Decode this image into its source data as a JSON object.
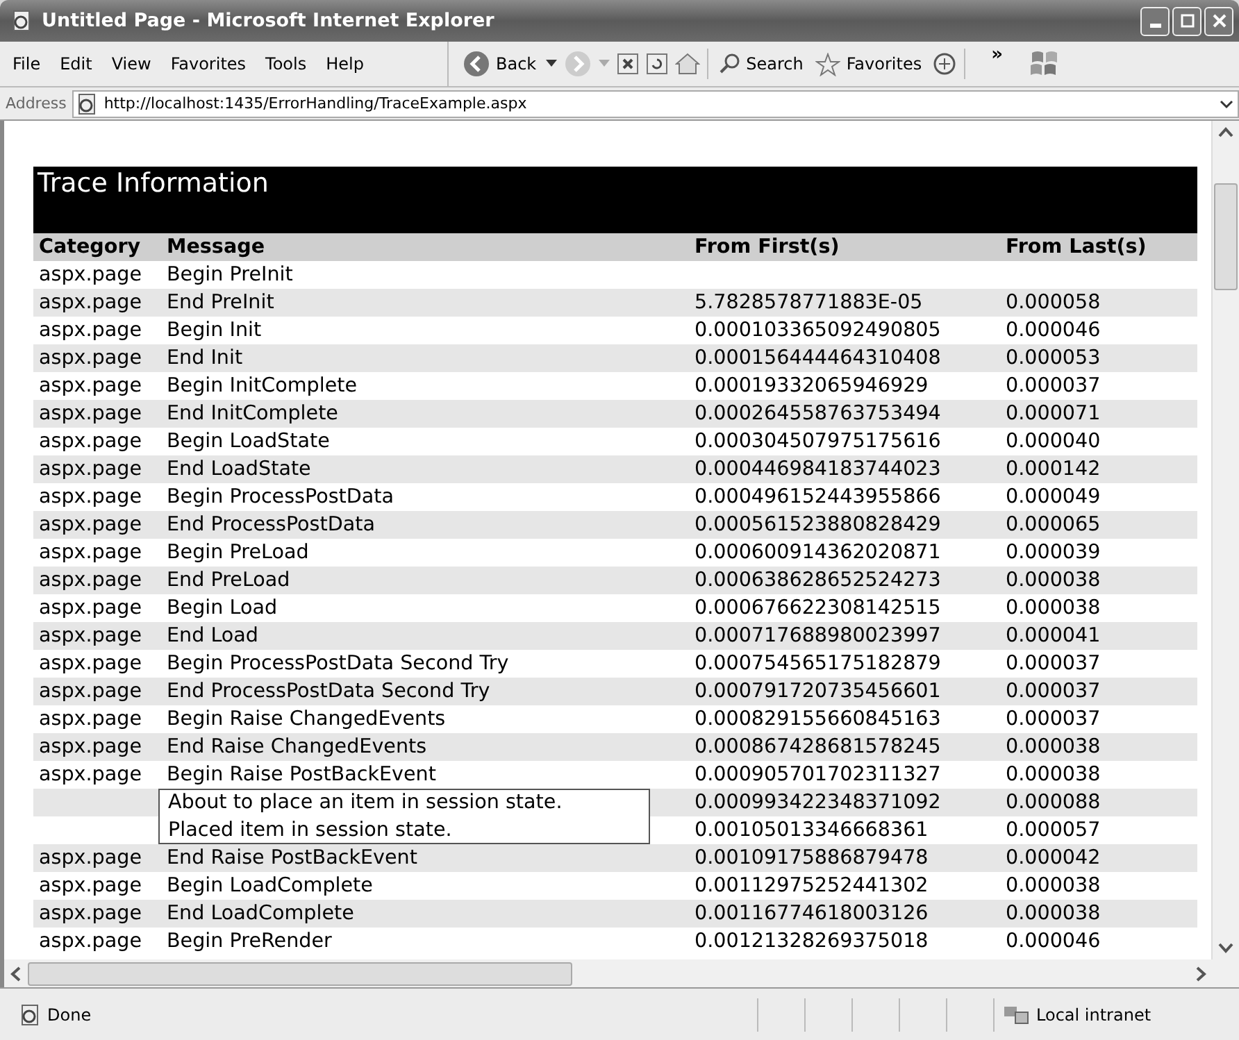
{
  "window": {
    "title": "Untitled Page - Microsoft Internet Explorer"
  },
  "menu": [
    "File",
    "Edit",
    "View",
    "Favorites",
    "Tools",
    "Help"
  ],
  "toolbar": {
    "back": "Back",
    "search": "Search",
    "favorites": "Favorites",
    "chevron": "»"
  },
  "address": {
    "label": "Address",
    "url": "http://localhost:1435/ErrorHandling/TraceExample.aspx"
  },
  "trace": {
    "title": "Trace Information",
    "columns": [
      "Category",
      "Message",
      "From First(s)",
      "From Last(s)"
    ],
    "rows": [
      {
        "kind": "event",
        "category": "aspx.page",
        "message": "Begin PreInit"
      },
      {
        "kind": "event",
        "category": "aspx.page",
        "message": "End PreInit",
        "from_first": "5.7828578771883E-05",
        "from_last": "0.000058"
      },
      {
        "kind": "event",
        "category": "aspx.page",
        "message": "Begin Init",
        "from_first": "0.000103365092490805",
        "from_last": "0.000046"
      },
      {
        "kind": "event",
        "category": "aspx.page",
        "message": "End Init",
        "from_first": "0.000156444464310408",
        "from_last": "0.000053"
      },
      {
        "kind": "event",
        "category": "aspx.page",
        "message": "Begin InitComplete",
        "from_first": "0.00019332065946929",
        "from_last": "0.000037"
      },
      {
        "kind": "event",
        "category": "aspx.page",
        "message": "End InitComplete",
        "from_first": "0.000264558763753494",
        "from_last": "0.000071"
      },
      {
        "kind": "event",
        "category": "aspx.page",
        "message": "Begin LoadState",
        "from_first": "0.000304507975175616",
        "from_last": "0.000040"
      },
      {
        "kind": "event",
        "category": "aspx.page",
        "message": "End LoadState",
        "from_first": "0.000446984183744023",
        "from_last": "0.000142"
      },
      {
        "kind": "event",
        "category": "aspx.page",
        "message": "Begin ProcessPostData",
        "from_first": "0.000496152443955866",
        "from_last": "0.000049"
      },
      {
        "kind": "event",
        "category": "aspx.page",
        "message": "End ProcessPostData",
        "from_first": "0.000561523880828429",
        "from_last": "0.000065"
      },
      {
        "kind": "event",
        "category": "aspx.page",
        "message": "Begin PreLoad",
        "from_first": "0.000600914362020871",
        "from_last": "0.000039"
      },
      {
        "kind": "event",
        "category": "aspx.page",
        "message": "End PreLoad",
        "from_first": "0.000638628652524273",
        "from_last": "0.000038"
      },
      {
        "kind": "event",
        "category": "aspx.page",
        "message": "Begin Load",
        "from_first": "0.000676622308142515",
        "from_last": "0.000038"
      },
      {
        "kind": "event",
        "category": "aspx.page",
        "message": "End Load",
        "from_first": "0.000717688980023997",
        "from_last": "0.000041"
      },
      {
        "kind": "event",
        "category": "aspx.page",
        "message": "Begin ProcessPostData Second Try",
        "from_first": "0.000754565175182879",
        "from_last": "0.000037"
      },
      {
        "kind": "event",
        "category": "aspx.page",
        "message": "End ProcessPostData Second Try",
        "from_first": "0.000791720735456601",
        "from_last": "0.000037"
      },
      {
        "kind": "event",
        "category": "aspx.page",
        "message": "Begin Raise ChangedEvents",
        "from_first": "0.000829155660845163",
        "from_last": "0.000037"
      },
      {
        "kind": "event",
        "category": "aspx.page",
        "message": "End Raise ChangedEvents",
        "from_first": "0.000867428681578245",
        "from_last": "0.000038"
      },
      {
        "kind": "event",
        "category": "aspx.page",
        "message": "Begin Raise PostBackEvent",
        "from_first": "0.000905701702311327",
        "from_last": "0.000038"
      },
      {
        "kind": "custom",
        "message": "About to place an item in session state.",
        "from_first": "0.000993422348371092",
        "from_last": "0.000088"
      },
      {
        "kind": "custom",
        "message": "Placed item in session state.",
        "from_first": "0.00105013346668361",
        "from_last": "0.000057"
      },
      {
        "kind": "event",
        "category": "aspx.page",
        "message": "End Raise PostBackEvent",
        "from_first": "0.00109175886879478",
        "from_last": "0.000042"
      },
      {
        "kind": "event",
        "category": "aspx.page",
        "message": "Begin LoadComplete",
        "from_first": "0.00112975252441302",
        "from_last": "0.000038"
      },
      {
        "kind": "event",
        "category": "aspx.page",
        "message": "End LoadComplete",
        "from_first": "0.00116774618003126",
        "from_last": "0.000038"
      },
      {
        "kind": "event",
        "category": "aspx.page",
        "message": "Begin PreRender",
        "from_first": "0.00121328269375018",
        "from_last": "0.000046"
      }
    ]
  },
  "status_bar": {
    "text": "Done",
    "zone": "Local intranet"
  }
}
